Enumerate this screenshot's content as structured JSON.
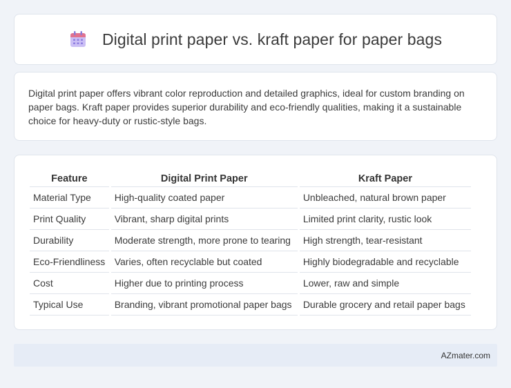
{
  "header": {
    "icon": "calendar-icon",
    "title": "Digital print paper vs. kraft paper for paper bags"
  },
  "intro": {
    "text": "Digital print paper offers vibrant color reproduction and detailed graphics, ideal for custom branding on paper bags. Kraft paper provides superior durability and eco-friendly qualities, making it a sustainable choice for heavy-duty or rustic-style bags."
  },
  "table": {
    "headers": [
      "Feature",
      "Digital Print Paper",
      "Kraft Paper"
    ],
    "rows": [
      [
        "Material Type",
        "High-quality coated paper",
        "Unbleached, natural brown paper"
      ],
      [
        "Print Quality",
        "Vibrant, sharp digital prints",
        "Limited print clarity, rustic look"
      ],
      [
        "Durability",
        "Moderate strength, more prone to tearing",
        "High strength, tear-resistant"
      ],
      [
        "Eco-Friendliness",
        "Varies, often recyclable but coated",
        "Highly biodegradable and recyclable"
      ],
      [
        "Cost",
        "Higher due to printing process",
        "Lower, raw and simple"
      ],
      [
        "Typical Use",
        "Branding, vibrant promotional paper bags",
        "Durable grocery and retail paper bags"
      ]
    ]
  },
  "footer": {
    "text": "AZmater.com"
  },
  "colors": {
    "background": "#f0f3f8",
    "card": "#ffffff",
    "footer_bg": "#e6ecf6",
    "icon_top": "#e1728f",
    "icon_body": "#b9a8f0"
  }
}
